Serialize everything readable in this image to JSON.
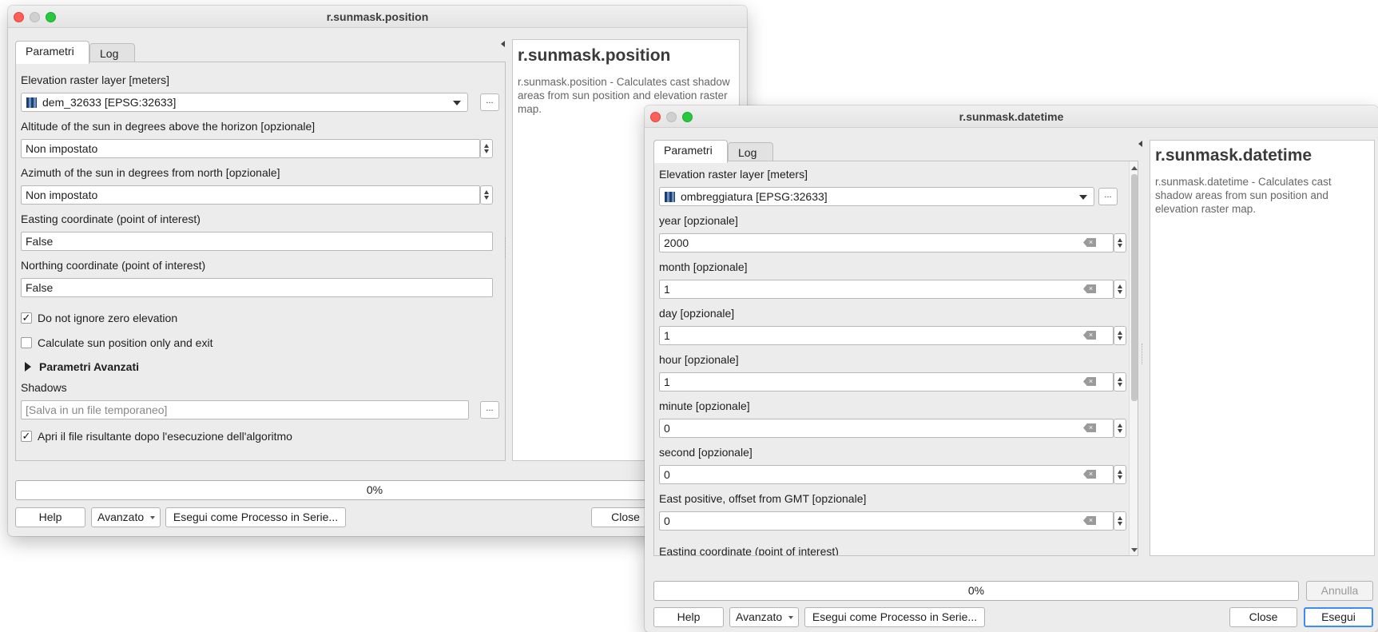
{
  "win1": {
    "title": "r.sunmask.position",
    "tabs": [
      "Parametri",
      "Log"
    ],
    "elevation_label": "Elevation raster layer [meters]",
    "elevation_value": "dem_32633 [EPSG:32633]",
    "altitude_label": "Altitude of the sun in degrees above the horizon [opzionale]",
    "altitude_value": "Non impostato",
    "azimuth_label": "Azimuth of the sun in degrees from north [opzionale]",
    "azimuth_value": "Non impostato",
    "easting_label": "Easting coordinate (point of interest)",
    "easting_value": "False",
    "northing_label": "Northing coordinate (point of interest)",
    "northing_value": "False",
    "zero_elev_label": "Do not ignore zero elevation",
    "zero_elev_checked": true,
    "sunpos_label": "Calculate sun position only and exit",
    "sunpos_checked": false,
    "advanced_label": "Parametri Avanzati",
    "shadows_label": "Shadows",
    "shadows_placeholder": "[Salva in un file temporaneo]",
    "open_result_label": "Apri il file risultante dopo l'esecuzione dell'algoritmo",
    "open_result_checked": true,
    "dots_label": "...",
    "help_title": "r.sunmask.position",
    "help_text": "r.sunmask.position - Calculates cast shadow areas from sun position and elevation raster map.",
    "progress": "0%",
    "buttons": {
      "help": "Help",
      "advanced": "Avanzato",
      "batch": "Esegui come Processo in Serie...",
      "close": "Close"
    }
  },
  "win2": {
    "title": "r.sunmask.datetime",
    "tabs": [
      "Parametri",
      "Log"
    ],
    "elevation_label": "Elevation raster layer [meters]",
    "elevation_value": "ombreggiatura [EPSG:32633]",
    "fields": [
      {
        "label": "year [opzionale]",
        "value": "2000"
      },
      {
        "label": "month [opzionale]",
        "value": "1"
      },
      {
        "label": "day [opzionale]",
        "value": "1"
      },
      {
        "label": "hour [opzionale]",
        "value": "1"
      },
      {
        "label": "minute [opzionale]",
        "value": "0"
      },
      {
        "label": "second [opzionale]",
        "value": "0"
      },
      {
        "label": "East positive, offset from GMT [opzionale]",
        "value": "0"
      }
    ],
    "cut_label": "Easting coordinate (point of interest)",
    "dots_label": "...",
    "help_title": "r.sunmask.datetime",
    "help_text": "r.sunmask.datetime - Calculates cast shadow areas from sun position and elevation raster map.",
    "progress": "0%",
    "buttons": {
      "cancel": "Annulla",
      "help": "Help",
      "advanced": "Avanzato",
      "batch": "Esegui come Processo in Serie...",
      "close": "Close",
      "run": "Esegui"
    }
  },
  "colors": {
    "accent": "#3f8cf0",
    "close_light": "#fe5f57",
    "zoom_light": "#28c840"
  }
}
